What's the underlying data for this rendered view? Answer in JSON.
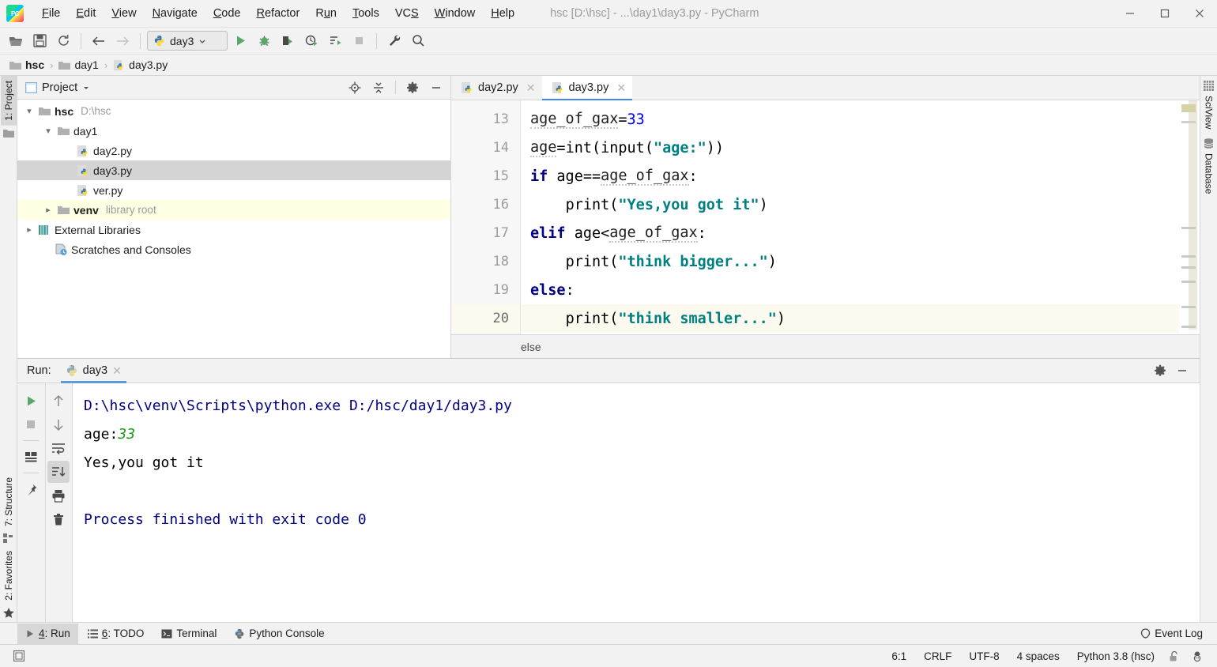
{
  "window": {
    "title": "hsc [D:\\hsc] - ...\\day1\\day3.py - PyCharm",
    "minimize": "—",
    "maximize": "☐",
    "close": "✕"
  },
  "menubar": {
    "items": [
      {
        "label": "File",
        "mnemonic": "F"
      },
      {
        "label": "Edit",
        "mnemonic": "E"
      },
      {
        "label": "View",
        "mnemonic": "V"
      },
      {
        "label": "Navigate",
        "mnemonic": "N"
      },
      {
        "label": "Code",
        "mnemonic": "C"
      },
      {
        "label": "Refactor",
        "mnemonic": "R"
      },
      {
        "label": "Run",
        "mnemonic": "u"
      },
      {
        "label": "Tools",
        "mnemonic": "T"
      },
      {
        "label": "VCS",
        "mnemonic": "S"
      },
      {
        "label": "Window",
        "mnemonic": "W"
      },
      {
        "label": "Help",
        "mnemonic": "H"
      }
    ]
  },
  "toolbar": {
    "open_icon": "open-folder-icon",
    "save_icon": "save-icon",
    "sync_icon": "refresh-icon",
    "back_icon": "back-arrow-icon",
    "forward_icon": "forward-arrow-icon",
    "run_config_name": "day3",
    "run_icon": "run-icon",
    "debug_icon": "debug-icon",
    "run_coverage_icon": "run-with-coverage-icon",
    "profile_icon": "profile-icon",
    "run_all_icon": "run-all-icon",
    "stop_icon": "stop-icon",
    "settings_icon": "wrench-icon",
    "search_icon": "search-icon"
  },
  "breadcrumbs": {
    "items": [
      {
        "label": "hsc",
        "icon": "folder-icon",
        "bold": true
      },
      {
        "label": "day1",
        "icon": "folder-icon",
        "bold": false
      },
      {
        "label": "day3.py",
        "icon": "python-file-icon",
        "bold": false
      }
    ],
    "separator": "›"
  },
  "left_strip": {
    "tabs": [
      {
        "label": "1: Project",
        "icon": "project-icon",
        "active": true
      },
      {
        "label": "7: Structure",
        "icon": "structure-icon",
        "active": false
      },
      {
        "label": "2: Favorites",
        "icon": "star-icon",
        "active": false
      }
    ]
  },
  "right_strip": {
    "tabs": [
      {
        "label": "SciView",
        "icon": "grid-icon"
      },
      {
        "label": "Database",
        "icon": "database-icon"
      }
    ]
  },
  "project_panel": {
    "title": "Project",
    "dropdown_icon": "chevron-down-icon",
    "locate_icon": "locate-icon",
    "collapse_icon": "collapse-all-icon",
    "settings_icon": "gear-icon",
    "minimize_icon": "minimize-icon",
    "tree": [
      {
        "label": "hsc",
        "sub": "D:\\hsc",
        "icon": "folder-icon",
        "indent": 0,
        "twisty": "expanded",
        "bold": true,
        "state": "normal"
      },
      {
        "label": "day1",
        "sub": "",
        "icon": "folder-icon",
        "indent": 1,
        "twisty": "expanded",
        "bold": false,
        "state": "normal"
      },
      {
        "label": "day2.py",
        "sub": "",
        "icon": "python-file-icon",
        "indent": 2,
        "twisty": "none",
        "bold": false,
        "state": "normal"
      },
      {
        "label": "day3.py",
        "sub": "",
        "icon": "python-file-icon",
        "indent": 2,
        "twisty": "none",
        "bold": false,
        "state": "selected"
      },
      {
        "label": "ver.py",
        "sub": "",
        "icon": "python-file-icon",
        "indent": 2,
        "twisty": "none",
        "bold": false,
        "state": "normal"
      },
      {
        "label": "venv",
        "sub": "library root",
        "icon": "folder-icon",
        "indent": 1,
        "twisty": "collapsed",
        "bold": true,
        "state": "venv"
      },
      {
        "label": "External Libraries",
        "sub": "",
        "icon": "library-icon",
        "indent": 0,
        "twisty": "collapsed",
        "bold": false,
        "state": "normal"
      },
      {
        "label": "Scratches and Consoles",
        "sub": "",
        "icon": "scratches-icon",
        "indent": 0,
        "twisty": "none",
        "bold": false,
        "state": "normal"
      }
    ]
  },
  "editor": {
    "tabs": [
      {
        "label": "day2.py",
        "icon": "python-file-icon",
        "active": false,
        "close": "✕"
      },
      {
        "label": "day3.py",
        "icon": "python-file-icon",
        "active": true,
        "close": "✕"
      }
    ],
    "breadcrumb": "else",
    "lines": [
      {
        "num": "13",
        "current": false
      },
      {
        "num": "14",
        "current": false
      },
      {
        "num": "15",
        "current": false
      },
      {
        "num": "16",
        "current": false
      },
      {
        "num": "17",
        "current": false
      },
      {
        "num": "18",
        "current": false
      },
      {
        "num": "19",
        "current": false
      },
      {
        "num": "20",
        "current": true
      }
    ],
    "code_text": [
      "age_of_gax=33",
      "age=int(input(\"age:\"))",
      "if age==age_of_gax:",
      "    print(\"Yes,you got it\")",
      "elif age<age_of_gax:",
      "    print(\"think bigger...\")",
      "else:",
      "    print(\"think smaller...\")"
    ],
    "colors": {
      "keyword": "#000080",
      "string": "#008080",
      "number": "#0000ff",
      "current_line_bg": "#fcfaef"
    }
  },
  "run_panel": {
    "label": "Run:",
    "tab_name": "day3",
    "tab_icon": "python-icon",
    "tab_close": "✕",
    "settings_icon": "gear-icon",
    "minimize_icon": "minimize-icon",
    "toolbar_left": [
      {
        "icon": "rerun-icon",
        "active": false
      },
      {
        "icon": "stop-icon",
        "active": false
      },
      {
        "icon": "layout-icon",
        "active": false
      },
      {
        "icon": "pin-icon",
        "active": false
      }
    ],
    "toolbar_right": [
      {
        "icon": "arrow-up-icon",
        "active": false
      },
      {
        "icon": "arrow-down-icon",
        "active": false
      },
      {
        "icon": "soft-wrap-icon",
        "active": false
      },
      {
        "icon": "scroll-to-end-icon",
        "active": true
      },
      {
        "icon": "print-icon",
        "active": false
      },
      {
        "icon": "trash-icon",
        "active": false
      }
    ],
    "console": [
      {
        "text": "D:\\hsc\\venv\\Scripts\\python.exe D:/hsc/day1/day3.py",
        "kind": "cmd"
      },
      {
        "text": "age:",
        "kind": "out",
        "input": "33"
      },
      {
        "text": "Yes,you got it",
        "kind": "out"
      },
      {
        "text": "",
        "kind": "out"
      },
      {
        "text": "Process finished with exit code 0",
        "kind": "end"
      }
    ]
  },
  "bottom_bar": {
    "buttons": [
      {
        "label": "4: Run",
        "icon": "run-icon",
        "active": true
      },
      {
        "label": "6: TODO",
        "icon": "todo-icon",
        "active": false
      },
      {
        "label": "Terminal",
        "icon": "terminal-icon",
        "active": false
      },
      {
        "label": "Python Console",
        "icon": "python-icon",
        "active": false
      }
    ],
    "event_log": {
      "label": "Event Log",
      "icon": "event-log-icon"
    }
  },
  "status_bar": {
    "left_icon": "toggle-panels-icon",
    "caret": "6:1",
    "line_separator": "CRLF",
    "encoding": "UTF-8",
    "indent": "4 spaces",
    "interpreter": "Python 3.8 (hsc)",
    "lock_icon": "unlocked-icon",
    "inspector_icon": "hector-inspector-icon"
  }
}
